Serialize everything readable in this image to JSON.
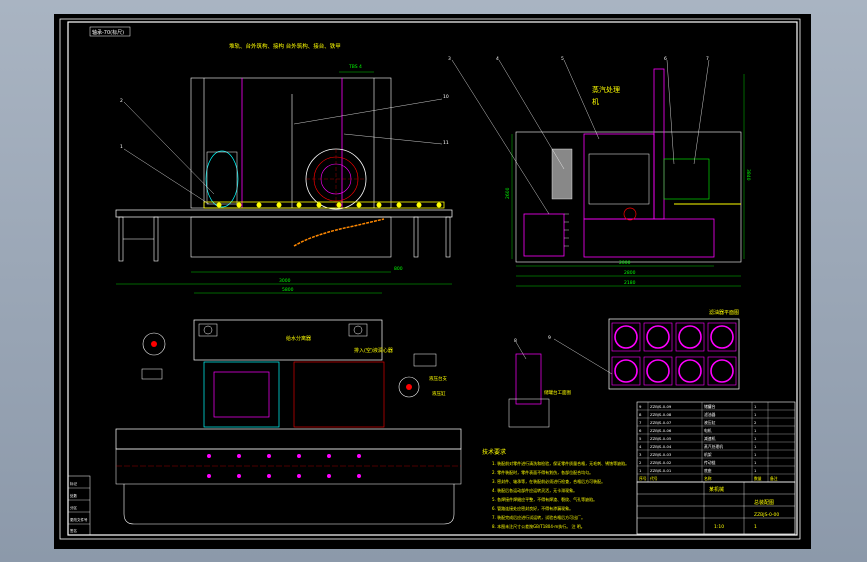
{
  "drawing": {
    "corner_label": "轴承-70(标尺)",
    "notes_top": "堆轨、台外筑构、接构          台外筑构、接台、铁甲",
    "dim_top_small": "TBS 4",
    "dim_front_1": "800",
    "dim_front_2": "3000",
    "dim_side_w1": "2000",
    "dim_side_w2": "2800",
    "dim_side_w3": "2180",
    "dim_side_h": "3840",
    "dim_side_h2": "2600",
    "dim_plan_top": "5800",
    "steam_label_1": "蒸汽处理",
    "steam_label_2": "机",
    "feeder_label_1": "给水分离器",
    "feeder_label_2": "排入(空)液润心器",
    "machine_label": "液压台支",
    "machine_label_2": "液压缸",
    "detail_label": "储罐台工面图",
    "grid_label": "滤油器平面图",
    "tech_title": "技术要求",
    "tech_notes": [
      "1. 装配前对零件进行清洗和检验，保证零件质量合格，无毛刺、锈蚀等缺陷。",
      "2. 零件装配时，零件表面不得有划伤，各部位配合均匀。",
      "3. 密封件、轴承等，在装配前必须进行检查，合格后方可装配。",
      "4. 装配后各运动部件应运转灵活，无卡滞现象。",
      "5. 各焊接件焊缝应平整，不得有焊渣、裂纹、气孔等缺陷。",
      "6. 管路连接处应密封良好，不得有渗漏现象。",
      "7. 装配完成后应进行试运转，试验合格后方可出厂。",
      "8. 本图未注尺寸公差按GB/T1804-m执行。 注 明。"
    ],
    "title_block": {
      "drawing_name": "总装配图",
      "company": "某机械",
      "drawing_no": "ZZBJS-0-00",
      "scale": "1:10",
      "sheet": "1",
      "left_rows": [
        "标记",
        "处数",
        "分区",
        "更改文件号",
        "签名"
      ]
    },
    "bom_rows": [
      [
        "9",
        "ZZBJS-0-09",
        "储罐台",
        "1",
        ""
      ],
      [
        "8",
        "ZZBJS-0-08",
        "滤油器",
        "1",
        ""
      ],
      [
        "7",
        "ZZBJS-0-07",
        "液压缸",
        "2",
        ""
      ],
      [
        "6",
        "ZZBJS-0-06",
        "电机",
        "1",
        ""
      ],
      [
        "5",
        "ZZBJS-0-05",
        "减速机",
        "1",
        ""
      ],
      [
        "4",
        "ZZBJS-0-04",
        "蒸汽处理机",
        "1",
        ""
      ],
      [
        "3",
        "ZZBJS-0-03",
        "机架",
        "1",
        ""
      ],
      [
        "2",
        "ZZBJS-0-02",
        "传动链",
        "1",
        ""
      ],
      [
        "1",
        "ZZBJS-0-01",
        "底座",
        "1",
        ""
      ]
    ],
    "bom_header": [
      "序号",
      "代号",
      "名称",
      "数量",
      "备注"
    ],
    "callouts": [
      "1",
      "2",
      "3",
      "4",
      "5",
      "6",
      "7",
      "8",
      "9",
      "10",
      "11"
    ]
  }
}
